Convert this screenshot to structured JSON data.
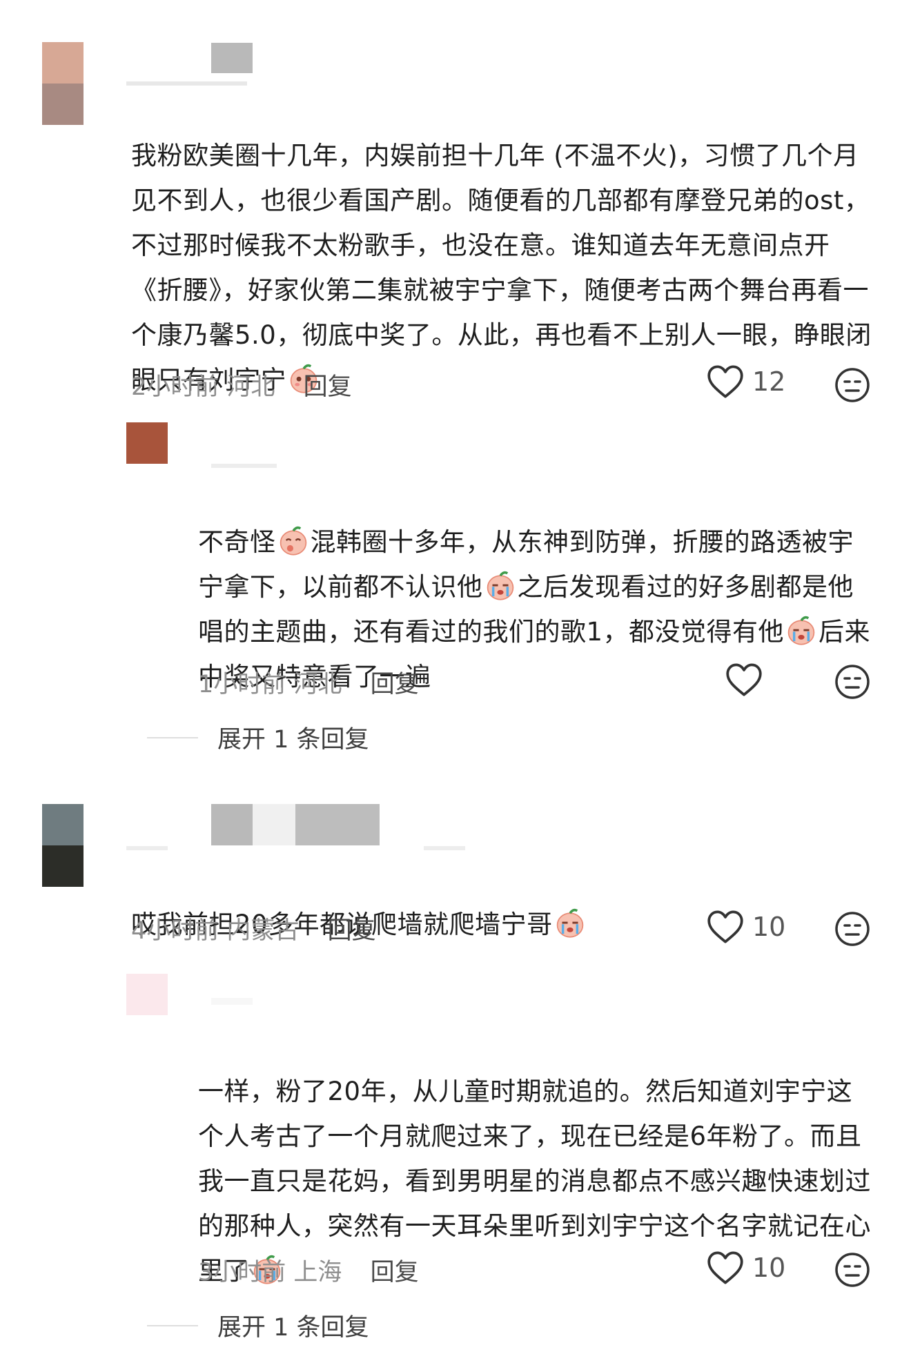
{
  "comments": [
    {
      "text": "我粉欧美圈十几年，内娱前担十几年 (不温不火)，习惯了几个月见不到人，也很少看国产剧。随便看的几部都有摩登兄弟的ost，不过那时候我不太粉歌手，也没在意。谁知道去年无意间点开《折腰》，好家伙第二集就被宇宁拿下，随便考古两个舞台再看一个康乃馨5.0，彻底中奖了。从此，再也看不上别人一眼，睁眼闭眼只有刘宇宁",
      "time": "2小时前",
      "location": "河北",
      "reply_label": "回复",
      "likes": "12"
    },
    {
      "text_a": "不奇怪",
      "text_b": "混韩圈十多年，从东神到防弹，折腰的路透被宇宁拿下，以前都不认识他",
      "text_c": "之后发现看过的好多剧都是他唱的主题曲，还有看过的我们的歌1，都没觉得有他",
      "text_d": "后来中奖又特意看了一遍",
      "time": "1小时前",
      "location": "河北",
      "reply_label": "回复",
      "likes": ""
    },
    {
      "text": "哎我前担20多年都说爬墙就爬墙宁哥",
      "time": "4小时前",
      "location": "内蒙古",
      "reply_label": "回复",
      "likes": "10"
    },
    {
      "text": "一样，粉了20年，从儿童时期就追的。然后知道刘宇宁这个人考古了一个月就爬过来了，现在已经是6年粉了。而且我一直只是花妈，看到男明星的消息都点不感兴趣快速划过的那种人，突然有一天耳朵里听到刘宇宁这个名字就记在心里了",
      "time": "3小时前",
      "location": "上海",
      "reply_label": "回复",
      "likes": "10"
    }
  ],
  "expand_1": "展开 1 条回复",
  "expand_2": "展开 1 条回复",
  "icons": {
    "like": "heart-outline-icon",
    "dislike": "meh-face-icon"
  },
  "colors": {
    "avatar1_top": "#d7a895",
    "avatar1_bottom": "#a88a82",
    "avatar2": "#a8543b",
    "avatar3_top": "#6f7c80",
    "avatar3_bottom": "#2c2d28",
    "avatar4": "#fbe8ec"
  }
}
